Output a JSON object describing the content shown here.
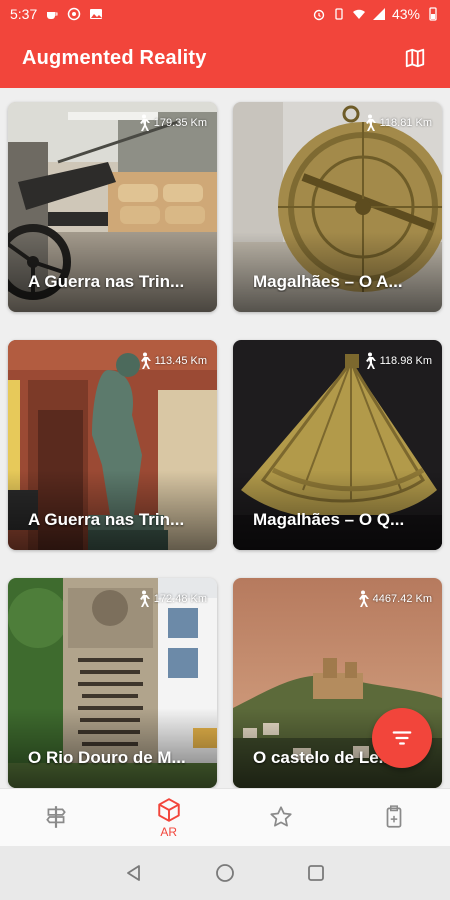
{
  "status_bar": {
    "time": "5:37",
    "battery": "43%"
  },
  "app_bar": {
    "title": "Augmented Reality",
    "map_icon": "map-icon"
  },
  "cards": [
    {
      "name": "A Guerra nas Trin...",
      "distance": "179.35 Km"
    },
    {
      "name": "Magalhães – O A...",
      "distance": "118.81 Km"
    },
    {
      "name": "A Guerra nas Trin...",
      "distance": "113.45 Km"
    },
    {
      "name": "Magalhães – O Q...",
      "distance": "118.98 Km"
    },
    {
      "name": "O Rio Douro de M...",
      "distance": "172.48 Km"
    },
    {
      "name": "O castelo de Le...",
      "distance": "4467.42 Km"
    }
  ],
  "fab": {
    "icon": "filter-icon"
  },
  "bottom_nav": {
    "items": [
      {
        "icon": "signpost-icon",
        "label": ""
      },
      {
        "icon": "ar-cube-icon",
        "label": "AR"
      },
      {
        "icon": "star-icon",
        "label": ""
      },
      {
        "icon": "ticket-icon",
        "label": ""
      }
    ]
  },
  "colors": {
    "primary": "#f2453b",
    "nav_inactive": "#8a8a8a"
  }
}
